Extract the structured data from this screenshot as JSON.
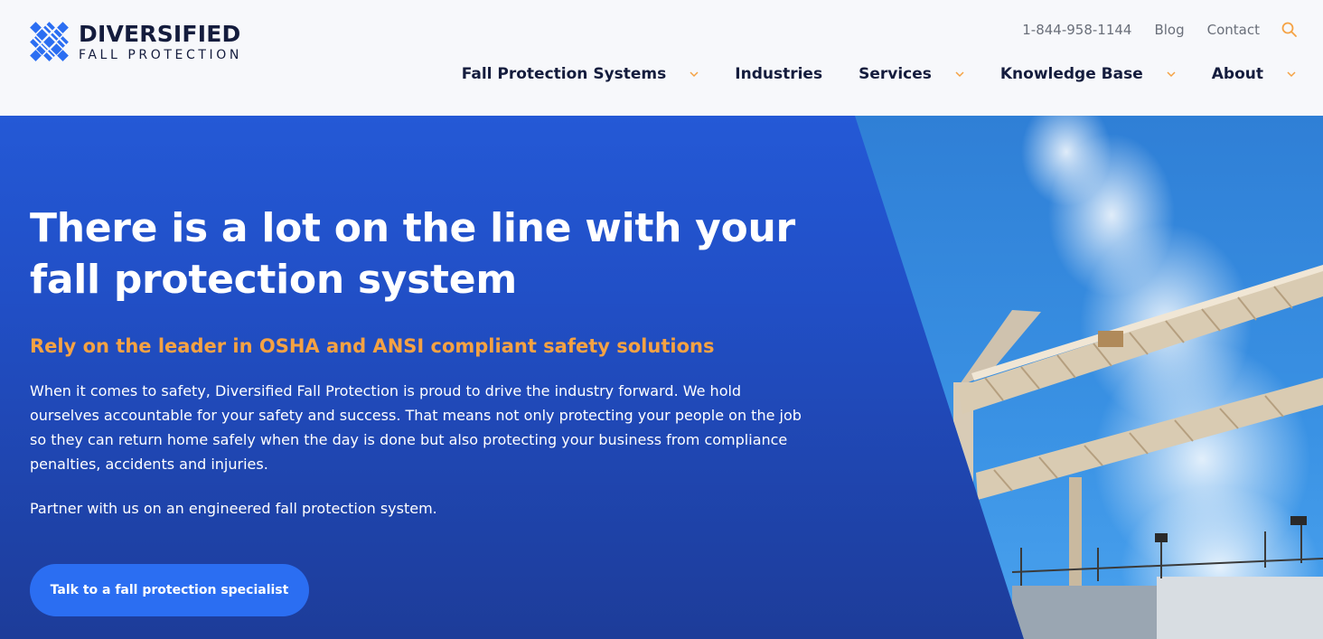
{
  "brand": {
    "name": "DIVERSIFIED",
    "tagline": "FALL PROTECTION",
    "colors": {
      "navy": "#141c3d",
      "blue": "#2b6ef2",
      "orange": "#f5a243"
    }
  },
  "utility_nav": {
    "phone": "1-844-958-1144",
    "blog": "Blog",
    "contact": "Contact",
    "search_icon": "search-icon"
  },
  "main_nav": {
    "items": [
      {
        "label": "Fall Protection Systems",
        "has_dropdown": true
      },
      {
        "label": "Industries",
        "has_dropdown": false
      },
      {
        "label": "Services",
        "has_dropdown": true
      },
      {
        "label": "Knowledge Base",
        "has_dropdown": true
      },
      {
        "label": "About",
        "has_dropdown": true
      }
    ]
  },
  "hero": {
    "title": "There is a lot on the line with your fall protection system",
    "subtitle": "Rely on the leader in OSHA and ANSI compliant safety solutions",
    "body": "When it comes to safety, Diversified Fall Protection is proud to drive the industry forward. We hold ourselves accountable for your safety and success. That means not only protecting your people on the job so they can return home safely when the day is done but also protecting your business from compliance penalties, accidents and injuries.",
    "body2": "Partner with us on an engineered fall protection system.",
    "cta": "Talk to a fall protection specialist"
  }
}
